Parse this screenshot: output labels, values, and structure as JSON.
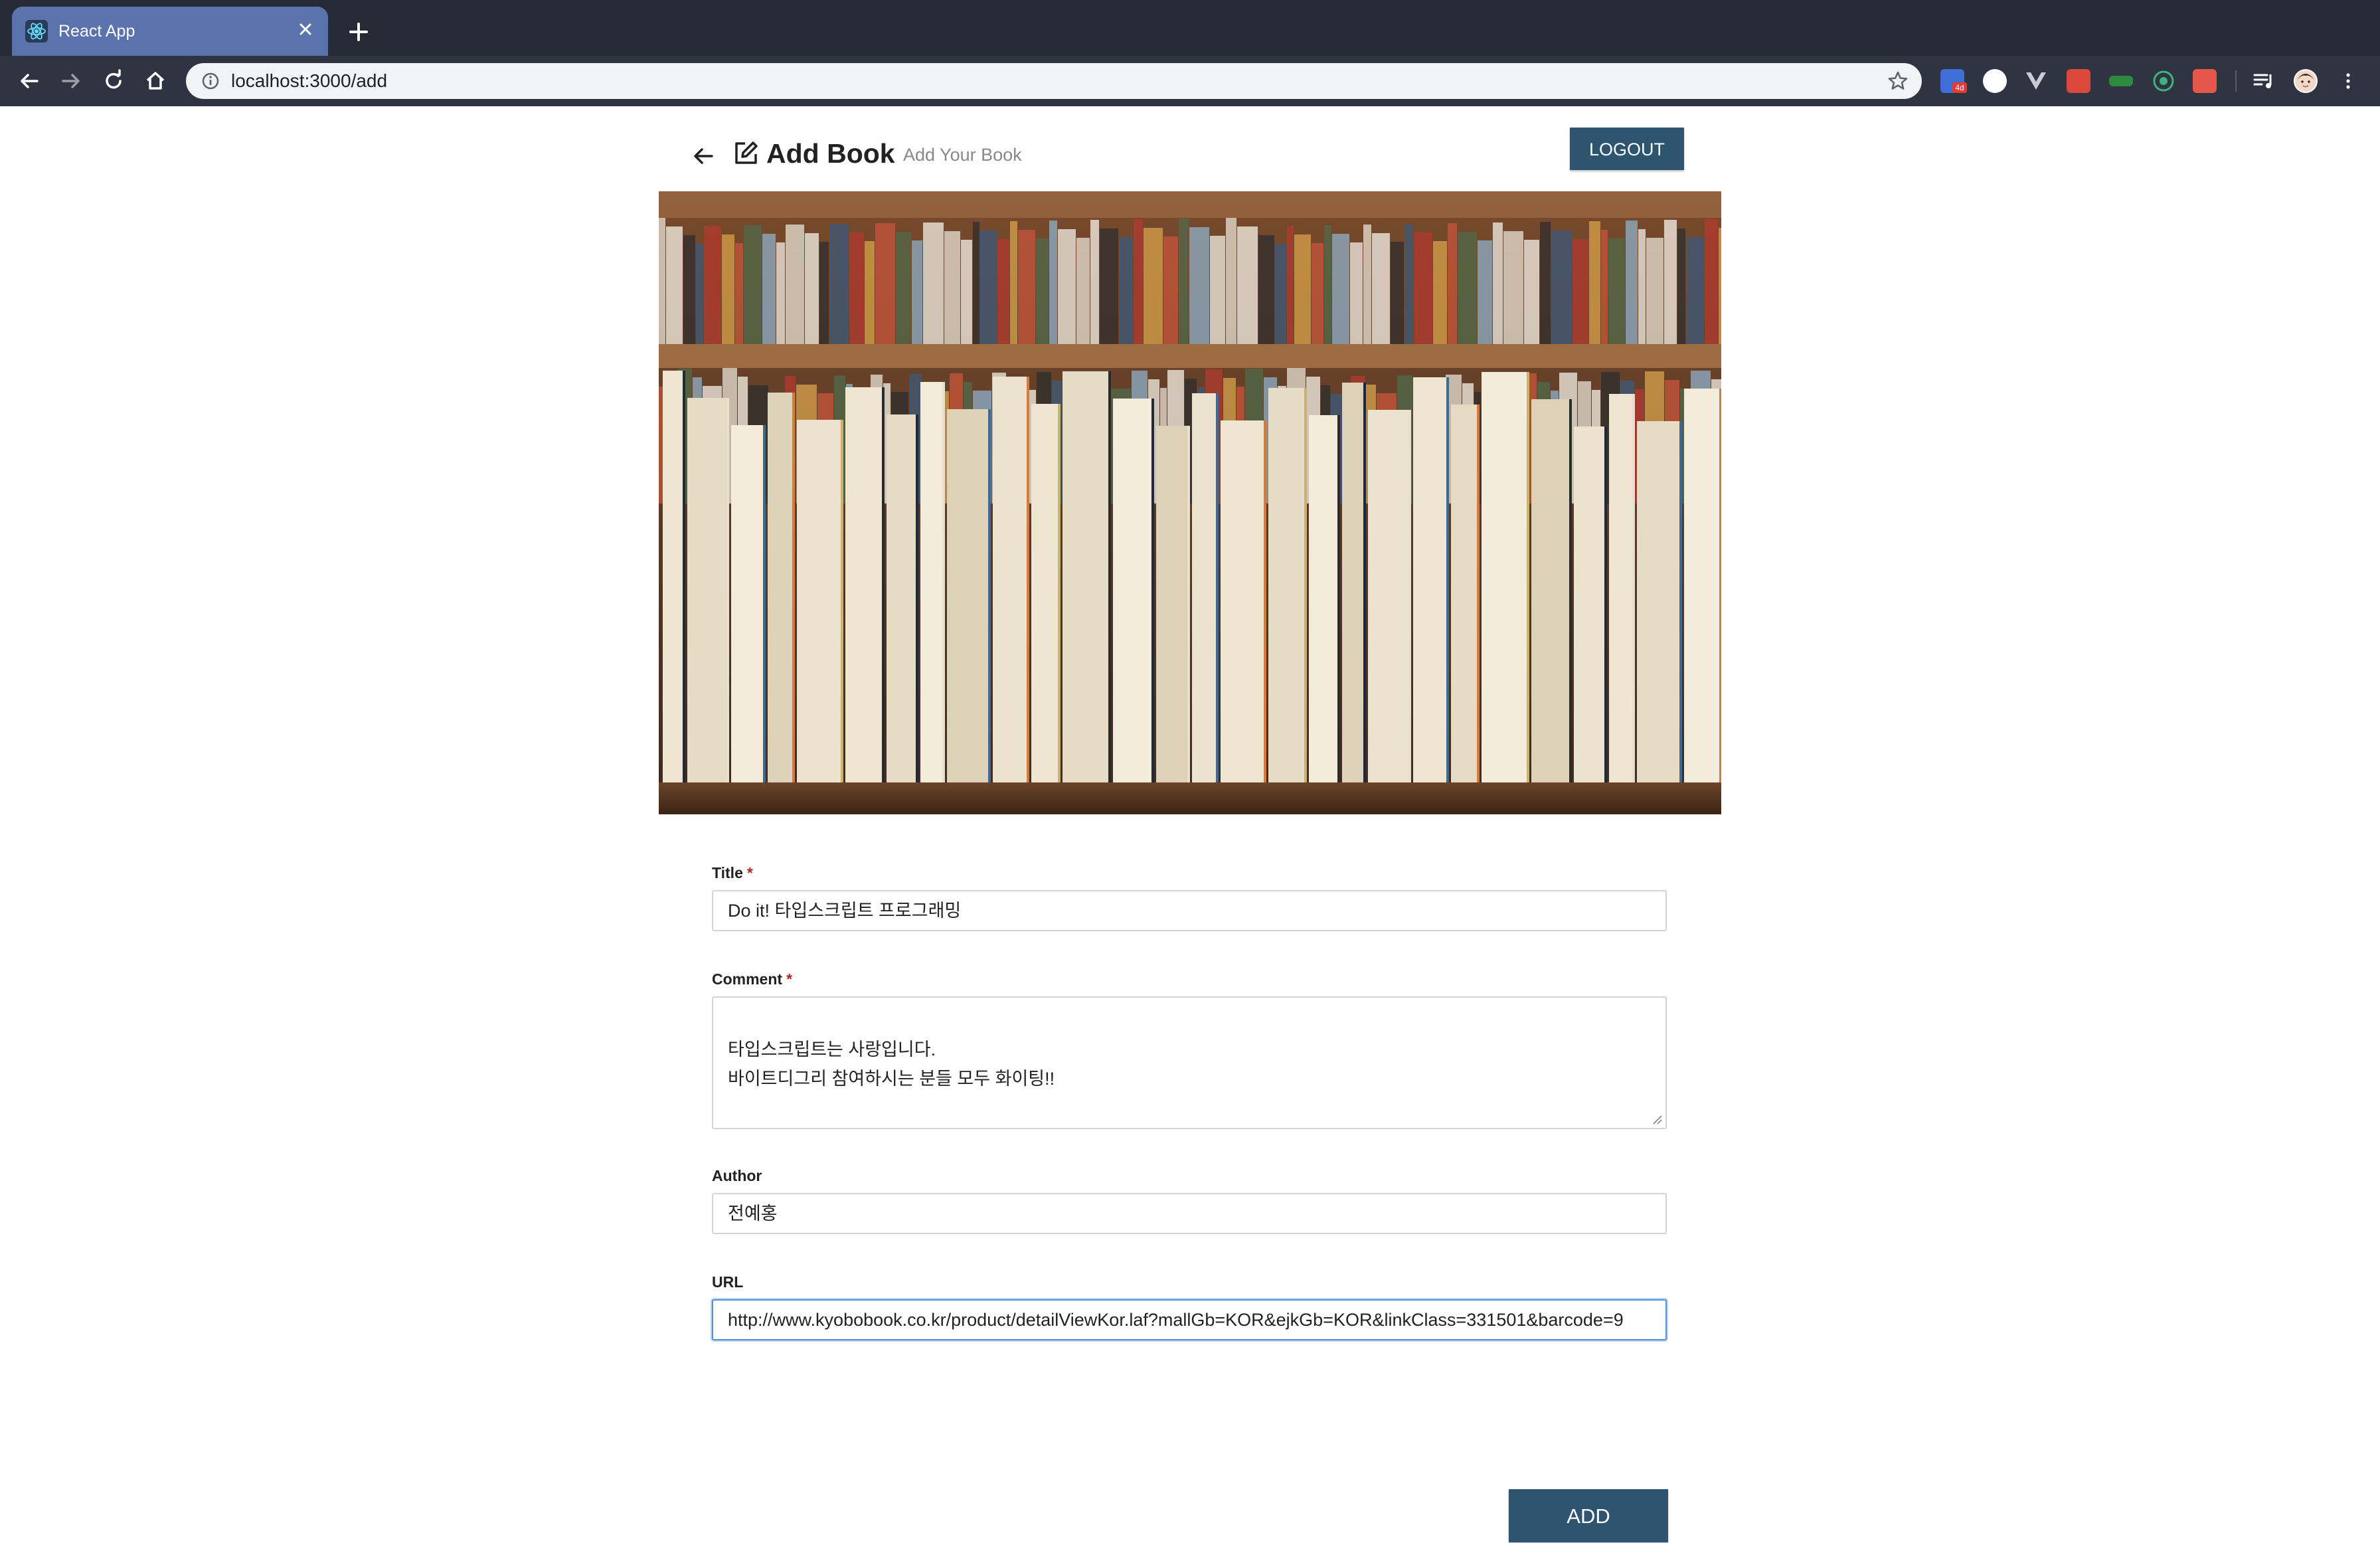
{
  "browser": {
    "tab_title": "React App",
    "address_url": "localhost:3000/add",
    "extension_badge": "4d"
  },
  "header": {
    "title": "Add Book",
    "subtitle": "Add Your Book",
    "logout_label": "LOGOUT"
  },
  "form": {
    "title": {
      "label": "Title",
      "required_mark": "*",
      "value": "Do it! 타입스크립트 프로그래밍"
    },
    "comment": {
      "label": "Comment",
      "required_mark": "*",
      "value": "타입스크립트는 사랑입니다.\n바이트디그리 참여하시는 분들 모두 화이팅!!"
    },
    "author": {
      "label": "Author",
      "value": "전예홍"
    },
    "url": {
      "label": "URL",
      "value": "http://www.kyobobook.co.kr/product/detailViewKor.laf?mallGb=KOR&ejkGb=KOR&linkClass=331501&barcode=9"
    },
    "submit_label": "ADD"
  },
  "colors": {
    "primary_button": "#2e5470",
    "tab_active": "#5b73ad",
    "browser_frame": "#262a35",
    "required": "#b3261e"
  },
  "icons": [
    "react-icon",
    "close-icon",
    "plus-icon",
    "back-icon",
    "forward-icon",
    "reload-icon",
    "home-icon",
    "info-icon",
    "star-icon",
    "arrow-left-icon",
    "edit-icon"
  ]
}
